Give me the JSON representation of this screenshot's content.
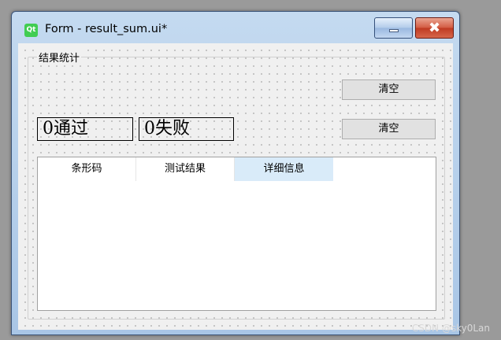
{
  "window": {
    "title": "Form - result_sum.ui*",
    "logo": "Qt"
  },
  "controls": {
    "minimize_icon": "minimize-icon",
    "close_icon": "close-icon",
    "close_glyph": "✖"
  },
  "group": {
    "title": "结果统计"
  },
  "buttons": {
    "clear_top": "清空",
    "clear_bottom": "清空"
  },
  "counters": {
    "pass": "0通过",
    "fail": "0失败"
  },
  "table": {
    "columns": [
      "条形码",
      "测试结果",
      "详细信息"
    ],
    "active_column": 2,
    "rows": []
  },
  "watermark": "CSDN @sky0Lan"
}
